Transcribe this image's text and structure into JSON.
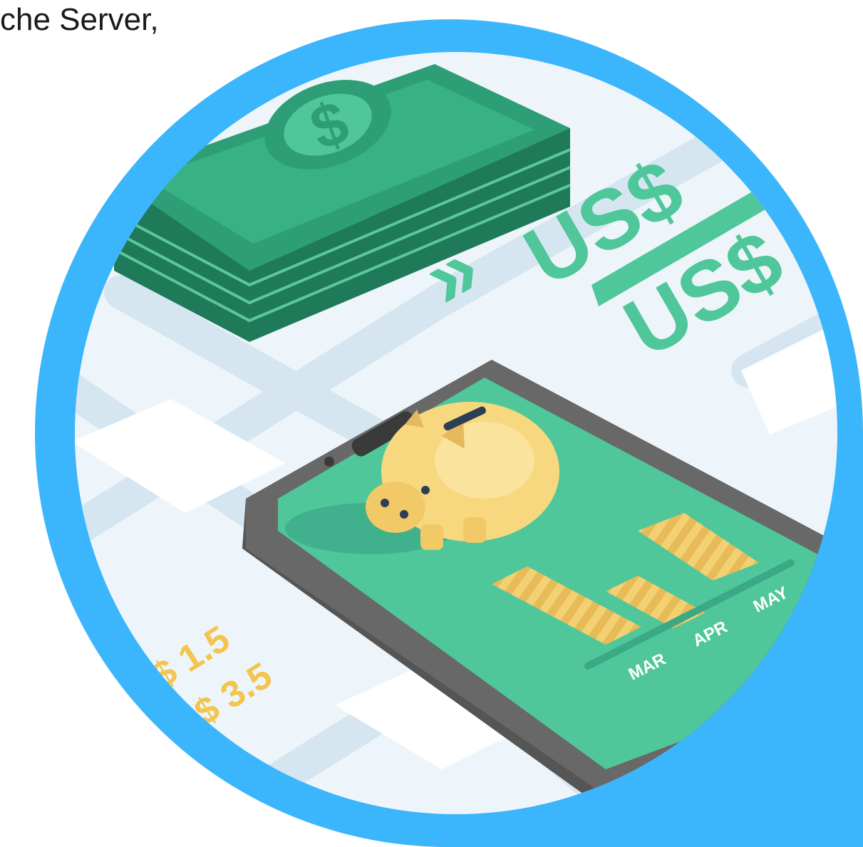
{
  "caption": "che Server,",
  "illustration": {
    "currency_labels": [
      "US$",
      "US$"
    ],
    "price_labels": [
      "$ 1.5",
      "S$ 3.5"
    ],
    "month_labels": [
      "MAR",
      "APR",
      "MAY"
    ],
    "icons": [
      "dollar-sign-icon",
      "chevron-double-right-icon",
      "piggy-bank-icon",
      "smartphone-icon",
      "bar-chart-icon"
    ],
    "colors": {
      "frame_blue": "#3bb5fb",
      "bill_green": "#2e9e76",
      "screen_green": "#4fc79a",
      "piggy_yellow": "#f7d87f",
      "bar_yellow": "#f3d173",
      "phone_gray": "#686868",
      "map_road": "#d5e6f1"
    }
  }
}
